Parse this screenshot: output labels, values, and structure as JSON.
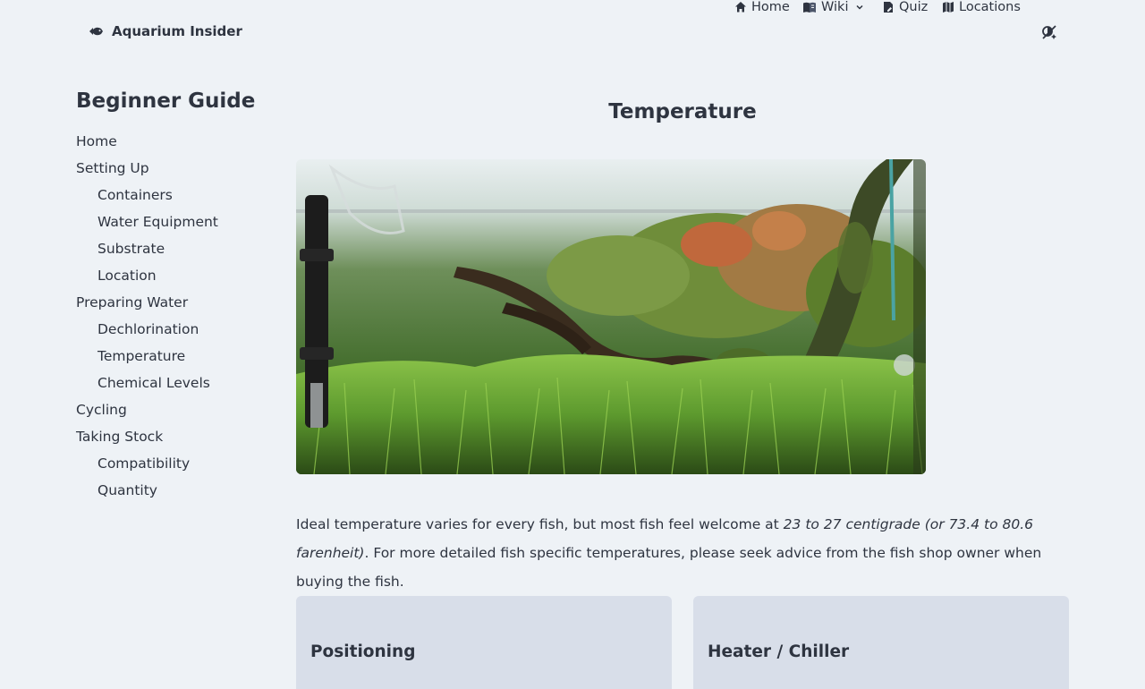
{
  "header": {
    "brand": "Aquarium Insider",
    "nav": [
      {
        "label": "Home",
        "icon": "home-icon"
      },
      {
        "label": "Wiki",
        "icon": "book-icon",
        "has_dropdown": true
      },
      {
        "label": "Quiz",
        "icon": "quiz-icon"
      },
      {
        "label": "Locations",
        "icon": "map-icon"
      }
    ],
    "theme_toggle_icon": "theme-toggle-icon"
  },
  "sidebar": {
    "title": "Beginner Guide",
    "items": [
      {
        "label": "Home",
        "level": 0
      },
      {
        "label": "Setting Up",
        "level": 0
      },
      {
        "label": "Containers",
        "level": 1
      },
      {
        "label": "Water Equipment",
        "level": 1
      },
      {
        "label": "Substrate",
        "level": 1
      },
      {
        "label": "Location",
        "level": 1
      },
      {
        "label": "Preparing Water",
        "level": 0
      },
      {
        "label": "Dechlorination",
        "level": 1
      },
      {
        "label": "Temperature",
        "level": 1
      },
      {
        "label": "Chemical Levels",
        "level": 1
      },
      {
        "label": "Cycling",
        "level": 0
      },
      {
        "label": "Taking Stock",
        "level": 0
      },
      {
        "label": "Compatibility",
        "level": 1
      },
      {
        "label": "Quantity",
        "level": 1
      }
    ]
  },
  "main": {
    "title": "Temperature",
    "paragraph": {
      "part1": "Ideal temperature varies for every fish, but most fish feel welcome at ",
      "emphasis": "23 to 27 centigrade (or 73.4 to 80.6 farenheit)",
      "part2": ". For more detailed fish specific temperatures, please seek advice from the fish shop owner when buying the fish."
    },
    "cards": [
      {
        "title": "Positioning"
      },
      {
        "title": "Heater / Chiller"
      }
    ]
  },
  "colors": {
    "background": "#eef2f6",
    "text": "#2e3440",
    "card": "#d8dee9"
  }
}
